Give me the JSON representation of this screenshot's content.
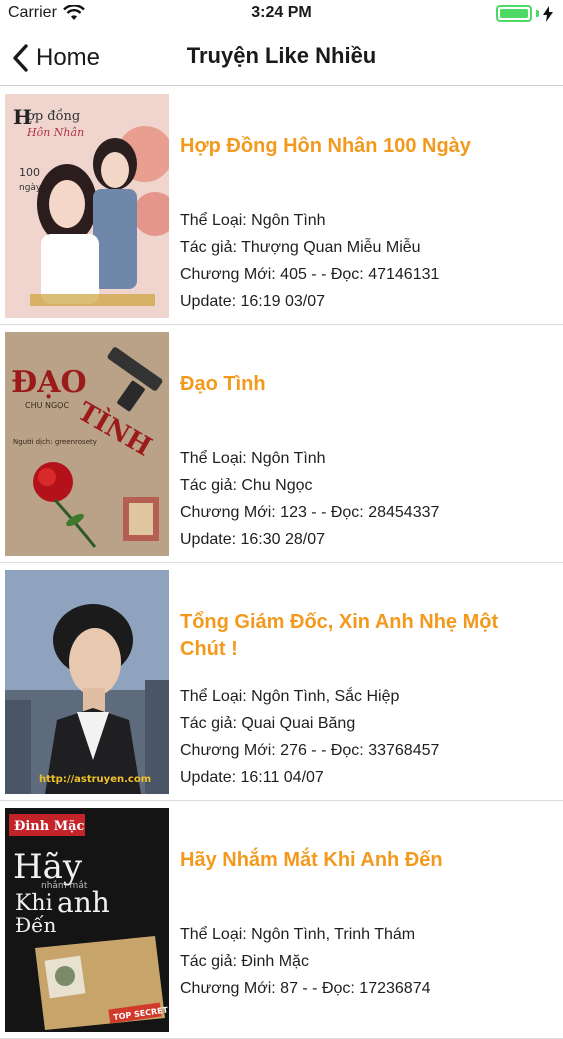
{
  "status_bar": {
    "carrier": "Carrier",
    "time": "3:24 PM"
  },
  "nav": {
    "back_label": "Home",
    "title": "Truyện Like Nhiều"
  },
  "stories": [
    {
      "title": "Hợp Đồng Hôn Nhân 100 Ngày",
      "genre": "Thể Loại: Ngôn Tình",
      "author": "Tác giả: Thượng Quan Miễu Miễu",
      "chapter": "Chương Mới: 405 -  - Đọc: 47146131",
      "update": "Update: 16:19 03/07",
      "cover_text": "Hợp đồng Hôn Nhân 100 ngày"
    },
    {
      "title": "Đạo Tình",
      "genre": "Thể Loại: Ngôn Tình",
      "author": "Tác giả: Chu Ngọc",
      "chapter": "Chương Mới: 123 -  - Đọc: 28454337",
      "update": "Update: 16:30 28/07",
      "cover_text": "ĐẠO TÌNH"
    },
    {
      "title": "Tổng Giám Đốc, Xin Anh Nhẹ Một Chút !",
      "genre": "Thể Loại: Ngôn Tình, Sắc Hiệp",
      "author": "Tác giả: Quai Quai Băng",
      "chapter": "Chương Mới: 276 -  - Đọc: 33768457",
      "update": "Update: 16:11 04/07",
      "cover_text": "http://astruyen.com"
    },
    {
      "title": "Hãy Nhắm Mắt Khi Anh Đến",
      "genre": "Thể Loại: Ngôn Tình, Trinh Thám",
      "author": "Tác giả: Đinh Mặc",
      "chapter": "Chương Mới: 87 -  - Đọc: 17236874",
      "update": "",
      "cover_text": "Đinh Mặc Hãy nhắm mắt khi anh đến"
    }
  ]
}
